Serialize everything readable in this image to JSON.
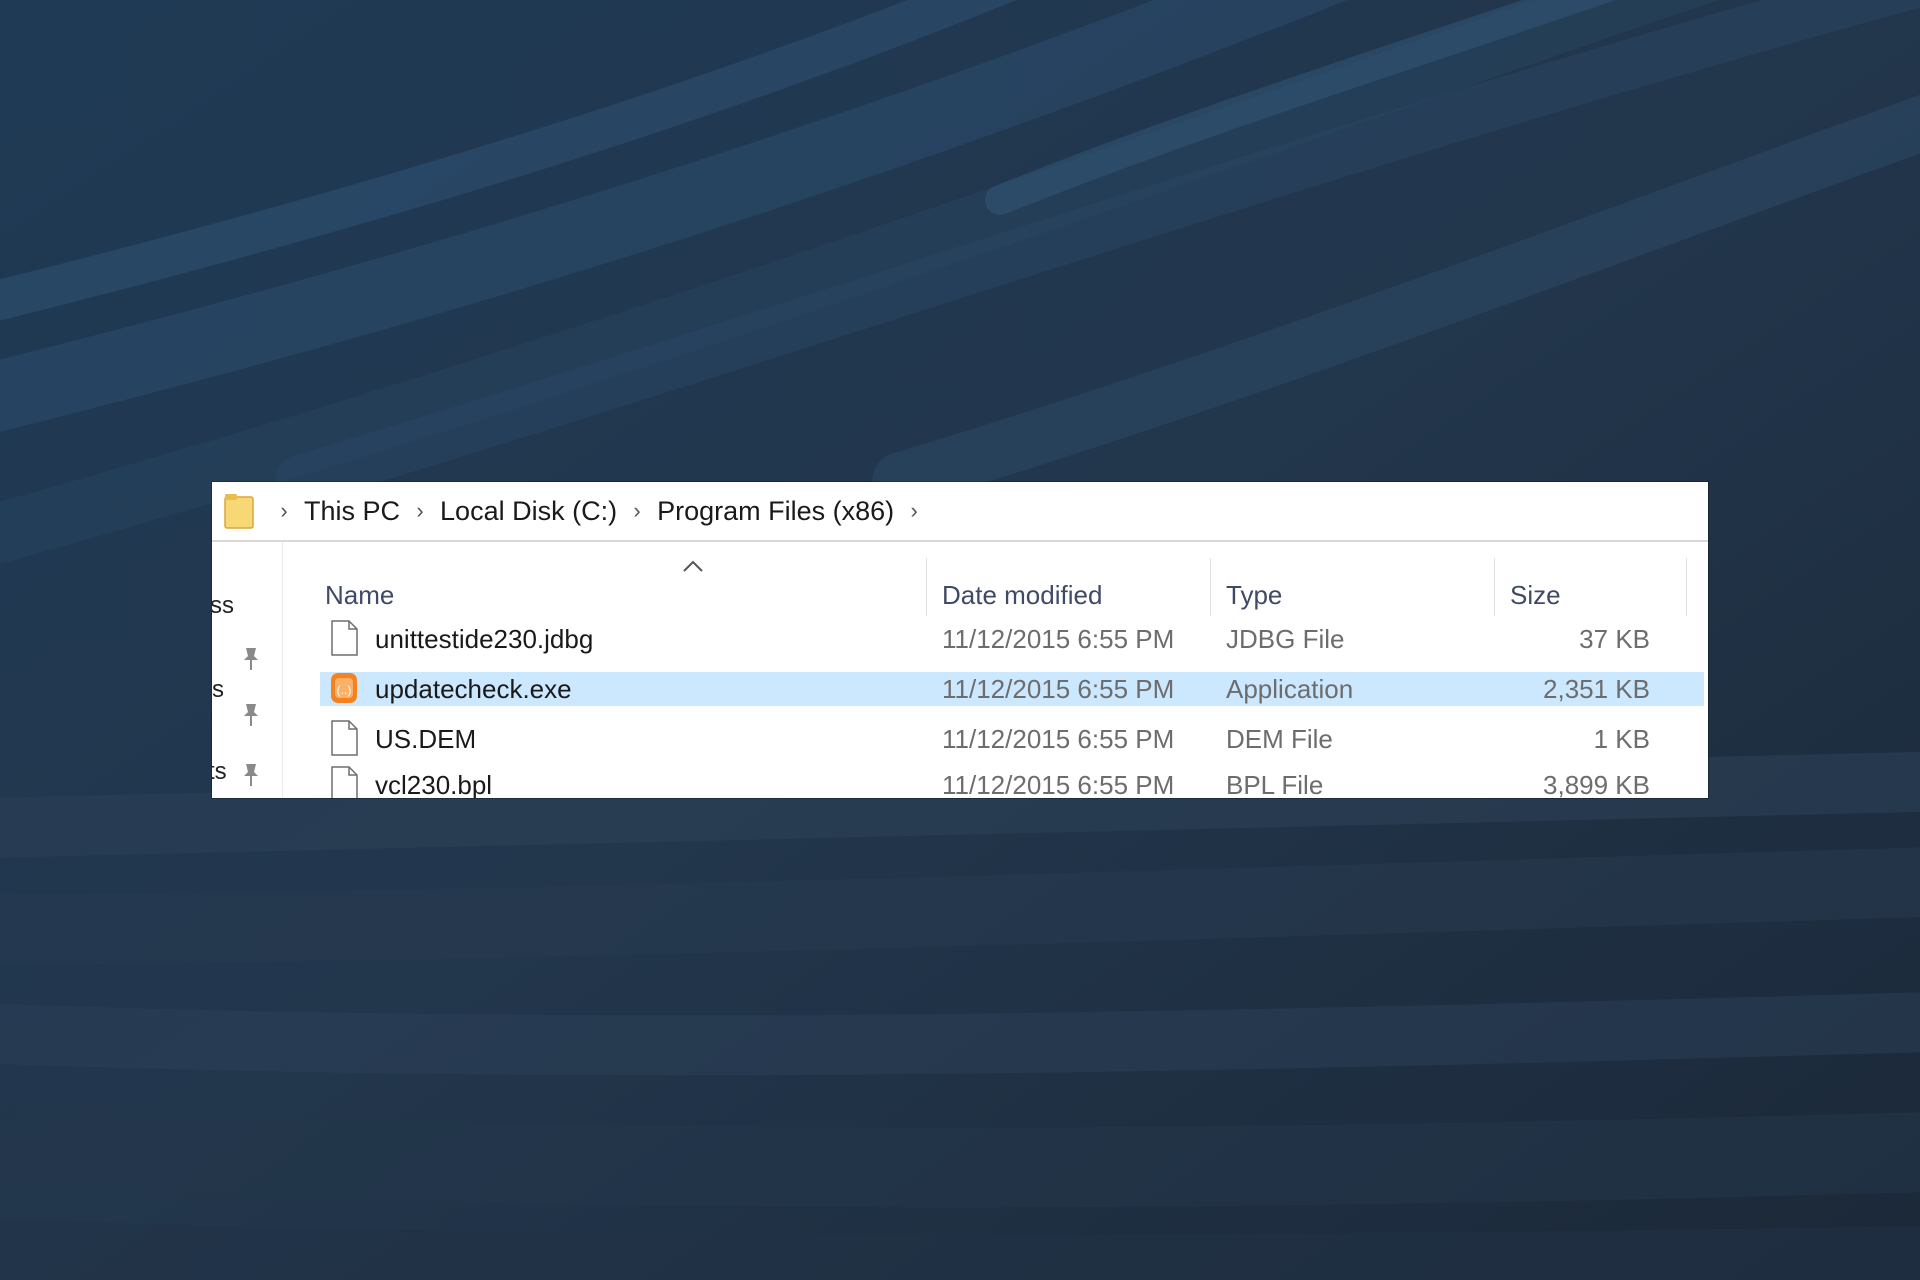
{
  "explorer": {
    "breadcrumb": [
      "This PC",
      "Local Disk (C:)",
      "Program Files (x86)"
    ],
    "columns": {
      "name": "Name",
      "date": "Date modified",
      "type": "Type",
      "size": "Size"
    },
    "nav_fragments": [
      "ss",
      "s",
      "ts"
    ],
    "files": [
      {
        "name": "unittestide230.jdbg",
        "date": "11/12/2015 6:55 PM",
        "type": "JDBG File",
        "size": "37 KB",
        "icon": "generic-file-icon"
      },
      {
        "name": "updatecheck.exe",
        "date": "11/12/2015 6:55 PM",
        "type": "Application",
        "size": "2,351 KB",
        "icon": "orange-app-icon",
        "selected": true
      },
      {
        "name": "US.DEM",
        "date": "11/12/2015 6:55 PM",
        "type": "DEM File",
        "size": "1 KB",
        "icon": "generic-file-icon"
      },
      {
        "name": "vcl230.bpl",
        "date": "11/12/2015 6:55 PM",
        "type": "BPL File",
        "size": "3,899 KB",
        "icon": "generic-file-icon"
      }
    ],
    "colors": {
      "selection": "#cce8ff",
      "folder": "#f8d775",
      "app_icon": "#f5821f",
      "header_text": "#3f4a66"
    }
  }
}
